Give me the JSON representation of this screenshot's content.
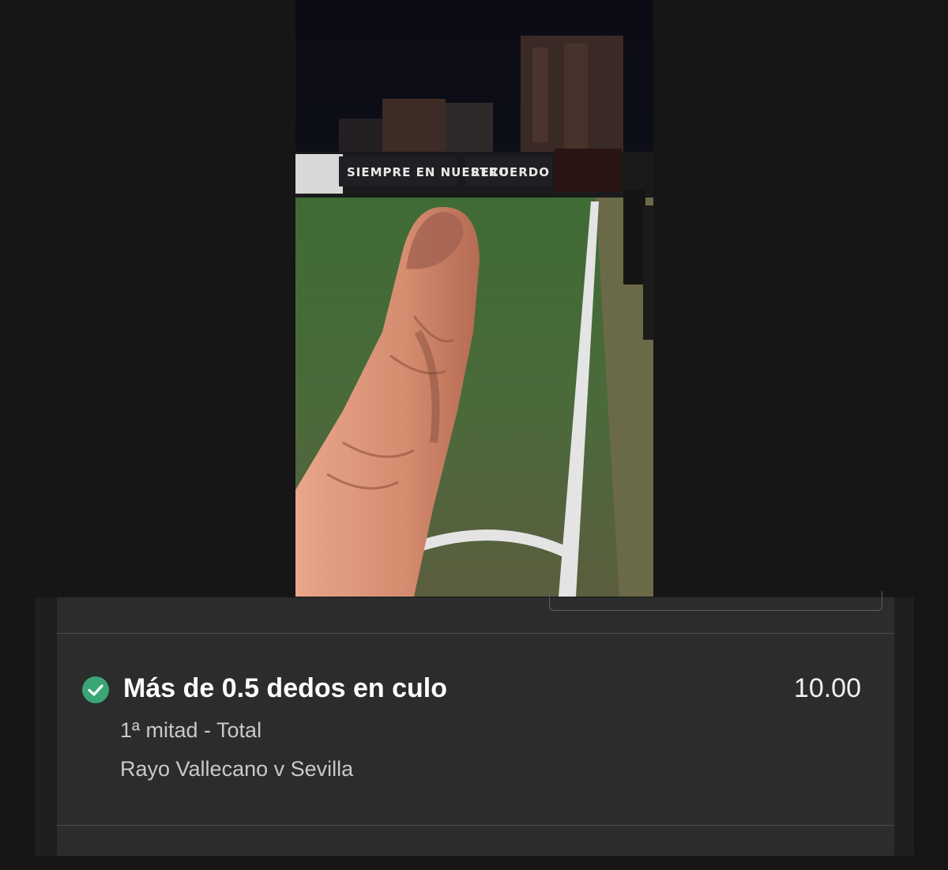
{
  "photo": {
    "description_icon": "photo-icon",
    "banner_left": "SIEMPRE EN NUESTRO",
    "banner_right": "RECUERDO"
  },
  "bet": {
    "status_icon": "check-circle-icon",
    "status_color": "#3aa676",
    "selection": "Más de 0.5 dedos en culo",
    "odds": "10.00",
    "market": "1ª mitad - Total",
    "event": "Rayo Vallecano v Sevilla"
  }
}
